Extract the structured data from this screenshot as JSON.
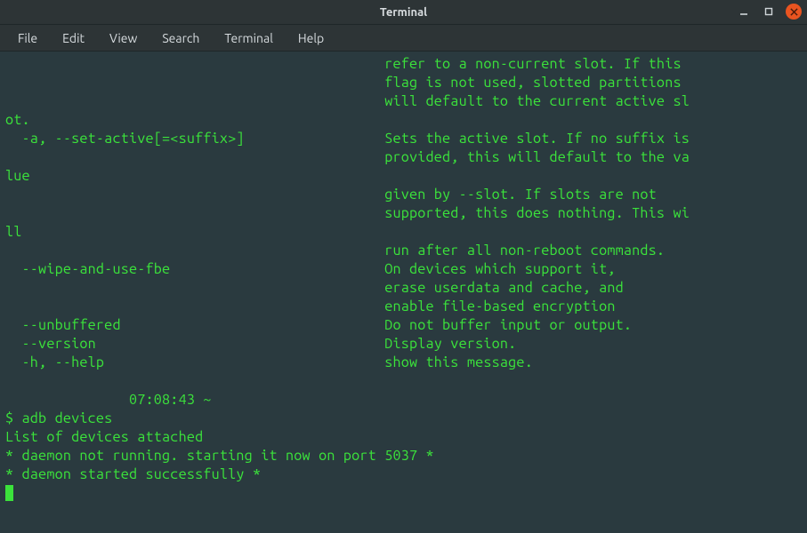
{
  "window": {
    "title": "Terminal"
  },
  "menu": {
    "items": [
      "File",
      "Edit",
      "View",
      "Search",
      "Terminal",
      "Help"
    ]
  },
  "terminal": {
    "lines": [
      "                                              refer to a non-current slot. If this",
      "                                              flag is not used, slotted partitions",
      "                                              will default to the current active sl",
      "ot.",
      "  -a, --set-active[=<suffix>]                 Sets the active slot. If no suffix is",
      "                                              provided, this will default to the va",
      "lue",
      "                                              given by --slot. If slots are not",
      "                                              supported, this does nothing. This wi",
      "ll",
      "                                              run after all non-reboot commands.",
      "  --wipe-and-use-fbe                          On devices which support it,",
      "                                              erase userdata and cache, and",
      "                                              enable file-based encryption",
      "  --unbuffered                                Do not buffer input or output.",
      "  --version                                   Display version.",
      "  -h, --help                                  show this message.",
      "",
      "               07:08:43 ~",
      "$ adb devices",
      "List of devices attached",
      "* daemon not running. starting it now on port 5037 *",
      "* daemon started successfully *"
    ]
  }
}
